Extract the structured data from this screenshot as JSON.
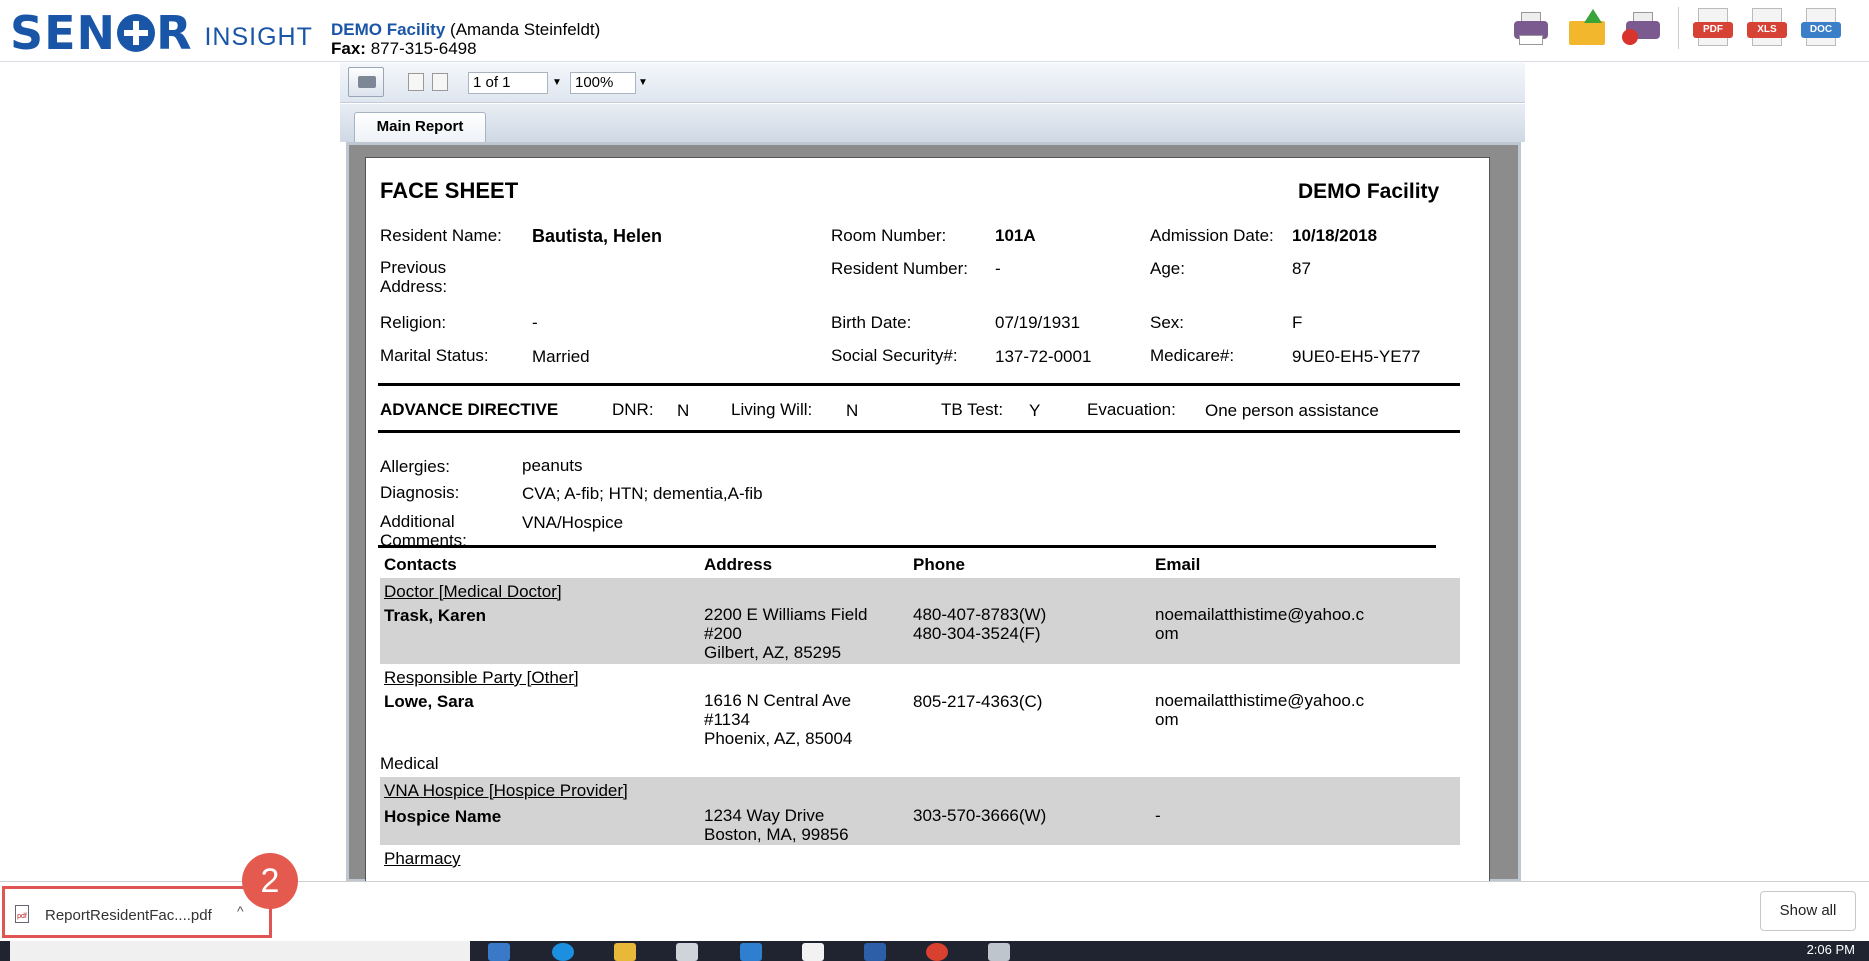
{
  "header": {
    "logo_main_left": "SEN",
    "logo_main_right": "R",
    "logo_sub": "INSIGHT",
    "facility_name": "DEMO Facility",
    "user": "(Amanda Steinfeldt)",
    "fax_label": "Fax:",
    "fax_number": "877-315-6498",
    "icons": [
      "printer-icon",
      "email-icon",
      "fax-icon",
      "pdf-icon",
      "xls-icon",
      "doc-icon"
    ],
    "pdf_tag": "PDF",
    "xls_tag": "XLS",
    "doc_tag": "DOC"
  },
  "viewer": {
    "page_value": "1 of 1",
    "zoom_value": "100%",
    "tab_label": "Main Report"
  },
  "report": {
    "title": "FACE SHEET",
    "facility": "DEMO Facility",
    "resident_name_label": "Resident Name:",
    "resident_name": "Bautista, Helen",
    "room_label": "Room Number:",
    "room": "101A",
    "admission_label": "Admission Date:",
    "admission": "10/18/2018",
    "prev_address_label": "Previous",
    "prev_address_label2": "Address:",
    "resident_number_label": "Resident Number:",
    "resident_number": "-",
    "age_label": "Age:",
    "age": "87",
    "religion_label": "Religion:",
    "religion": "-",
    "birth_label": "Birth Date:",
    "birth": "07/19/1931",
    "sex_label": "Sex:",
    "sex": "F",
    "marital_label": "Marital Status:",
    "marital": "Married",
    "ssn_label": "Social Security#:",
    "ssn": "137-72-0001",
    "medicare_label": "Medicare#:",
    "medicare": "9UE0-EH5-YE77",
    "advance_directive": "ADVANCE DIRECTIVE",
    "dnr_label": "DNR:",
    "dnr": "N",
    "living_will_label": "Living Will:",
    "living_will": "N",
    "tb_label": "TB Test:",
    "tb": "Y",
    "evac_label": "Evacuation:",
    "evac": "One person assistance",
    "allergies_label": "Allergies:",
    "allergies": "peanuts",
    "diagnosis_label": "Diagnosis:",
    "diagnosis": "CVA; A-fib; HTN; dementia,A-fib",
    "comments_label": "Additional",
    "comments_label2": "Comments:",
    "comments": "VNA/Hospice",
    "col_contacts": "Contacts",
    "col_address": "Address",
    "col_phone": "Phone",
    "col_email": "Email",
    "contacts": [
      {
        "type": "Doctor [Medical Doctor]",
        "name": "Trask, Karen",
        "address": [
          "2200 E Williams Field",
          "#200",
          "Gilbert, AZ, 85295"
        ],
        "phone": [
          "480-407-8783(W)",
          "480-304-3524(F)"
        ],
        "email": [
          "noemailatthistime@yahoo.c",
          "om"
        ]
      },
      {
        "type": "Responsible Party [Other]",
        "name": "Lowe, Sara",
        "address": [
          "1616 N Central Ave",
          "#1134",
          "Phoenix, AZ, 85004"
        ],
        "phone": [
          "805-217-4363(C)"
        ],
        "email": [
          "noemailatthistime@yahoo.c",
          "om"
        ],
        "extra": "Medical"
      },
      {
        "type": "VNA Hospice [Hospice Provider]",
        "name": "Hospice Name",
        "address": [
          "1234 Way Drive",
          "Boston, MA, 99856"
        ],
        "phone": [
          "303-570-3666(W)"
        ],
        "email": [
          "-"
        ]
      },
      {
        "type": "Pharmacy"
      }
    ]
  },
  "downloads": {
    "file_name": "ReportResidentFac....pdf",
    "file_icon_text": "pdf",
    "chevron": "^",
    "badge": "2",
    "show_all": "Show all"
  },
  "taskbar": {
    "clock": "2:06 PM"
  }
}
